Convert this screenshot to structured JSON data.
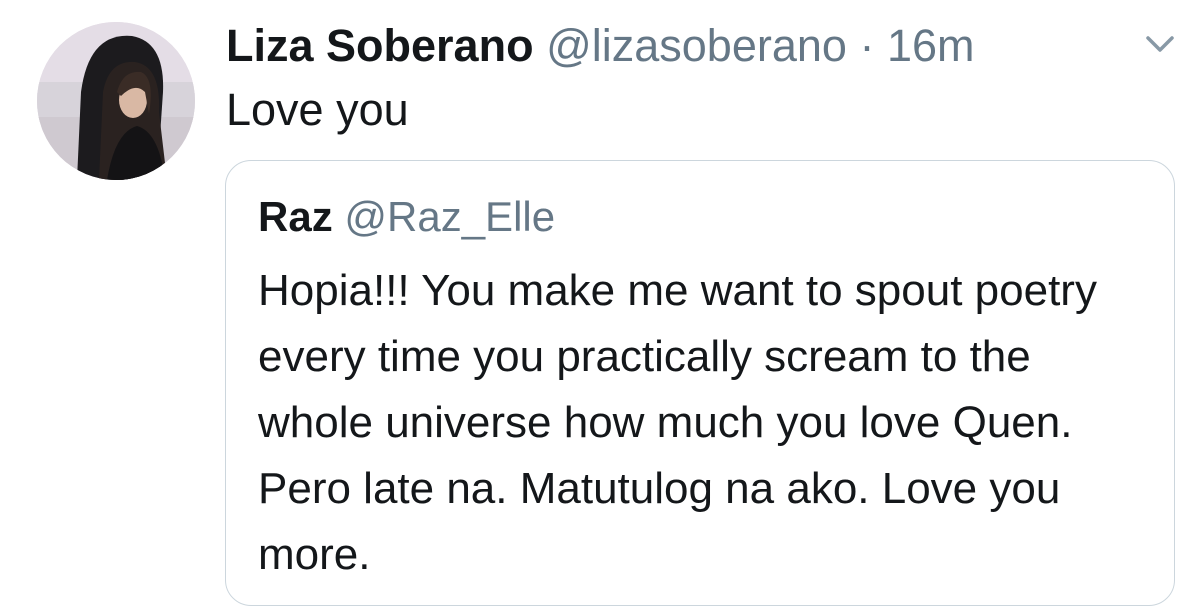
{
  "tweet": {
    "author_name": "Liza Soberano",
    "author_handle": "@lizasoberano",
    "separator": "·",
    "time": "16m",
    "text": "Love you"
  },
  "quoted_tweet": {
    "author_name": "Raz",
    "author_handle": "@Raz_Elle",
    "text": "Hopia!!! You make me want to spout poetry every time you practically scream to the whole universe how much you love Quen. Pero late na. Matutulog na ako. Love you more."
  },
  "icons": {
    "menu": "chevron-down-icon"
  },
  "colors": {
    "primary_text": "#14171a",
    "secondary_text": "#657786",
    "border": "#ccd6dd",
    "background": "#ffffff"
  }
}
